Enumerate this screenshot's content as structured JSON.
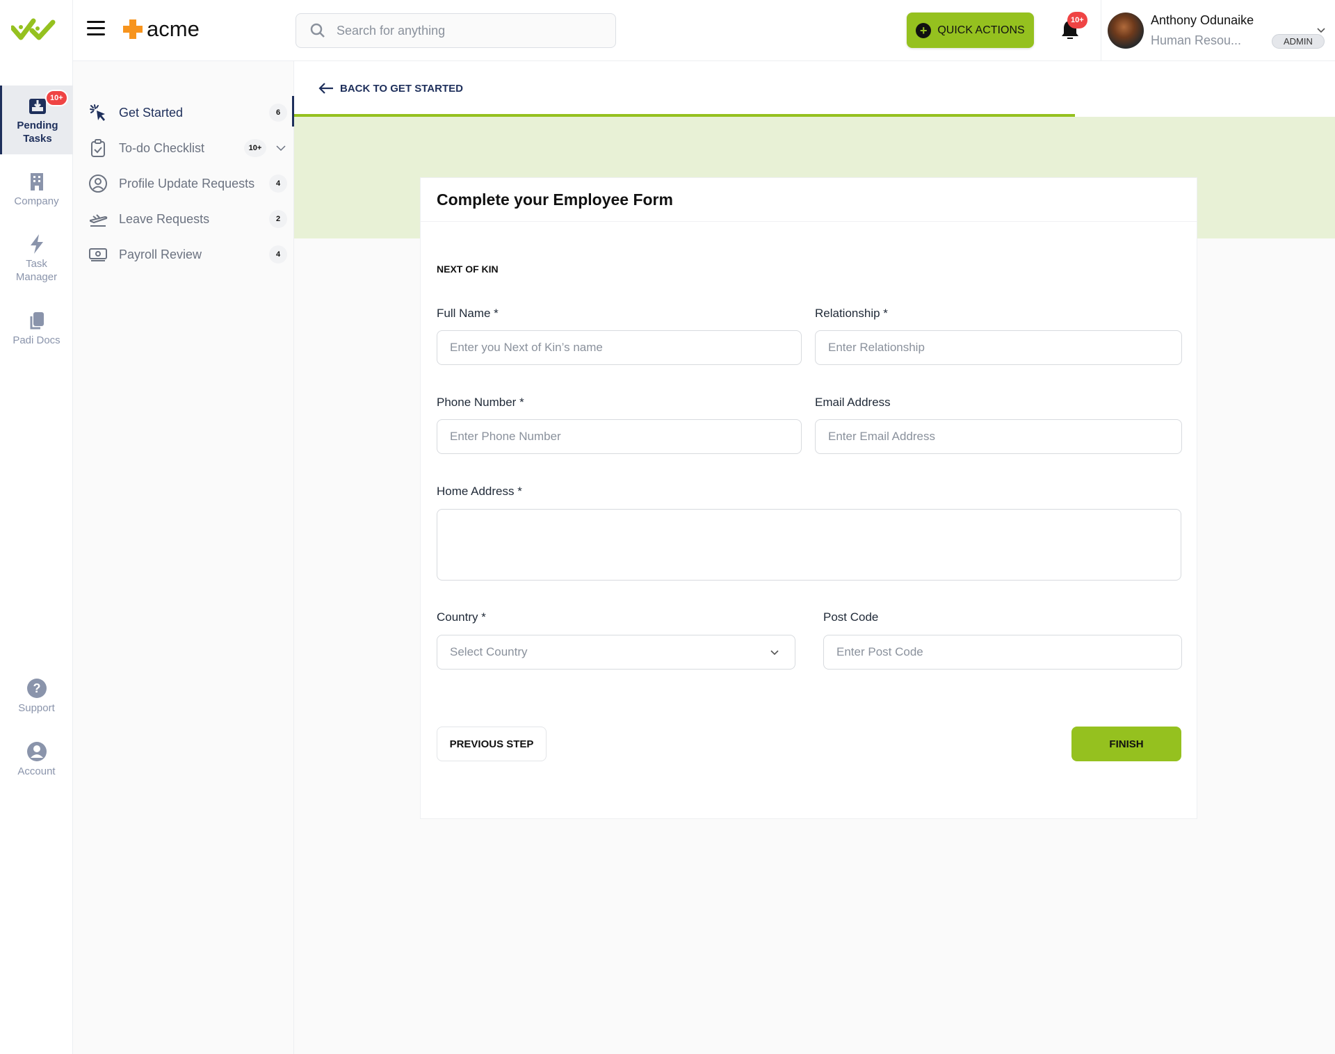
{
  "rail": {
    "items": [
      {
        "label_1": "Pending",
        "label_2": "Tasks",
        "badge": "10+",
        "active": true
      },
      {
        "label": "Company"
      },
      {
        "label_1": "Task",
        "label_2": "Manager"
      },
      {
        "label": "Padi Docs"
      }
    ],
    "bottom": [
      {
        "label": "Support"
      },
      {
        "label": "Account"
      }
    ]
  },
  "header": {
    "brand": "acme",
    "search_placeholder": "Search for anything",
    "quick_actions_label": "QUICK ACTIONS",
    "notifications_badge": "10+",
    "user": {
      "name": "Anthony Odunaike",
      "role": "Human Resou...",
      "badge": "ADMIN"
    }
  },
  "panel": {
    "items": [
      {
        "label": "Get Started",
        "count": "6",
        "active": true
      },
      {
        "label": "To-do Checklist",
        "count": "10+",
        "expandable": true
      },
      {
        "label": "Profile Update Requests",
        "count": "4"
      },
      {
        "label": "Leave Requests",
        "count": "2"
      },
      {
        "label": "Payroll Review",
        "count": "4"
      }
    ]
  },
  "main": {
    "back_label": "BACK TO GET STARTED",
    "progress_percent": 75,
    "colors": {
      "accent": "#95c11f",
      "navy": "#1e2f5b",
      "band": "#e8f1d6",
      "badge": "#ef4444"
    },
    "form": {
      "title": "Complete your Employee Form",
      "section": "NEXT OF KIN",
      "fields": {
        "full_name": {
          "label": "Full Name *",
          "placeholder": "Enter you Next of Kin’s name",
          "value": ""
        },
        "relationship": {
          "label": "Relationship *",
          "placeholder": "Enter Relationship",
          "value": ""
        },
        "phone": {
          "label": "Phone Number *",
          "placeholder": "Enter Phone Number",
          "value": ""
        },
        "email": {
          "label": "Email Address",
          "placeholder": "Enter Email Address",
          "value": ""
        },
        "home_address": {
          "label": "Home Address *",
          "placeholder": "",
          "value": ""
        },
        "country": {
          "label": "Country *",
          "selected": "Select Country"
        },
        "post_code": {
          "label": "Post Code",
          "placeholder": "Enter Post Code",
          "value": ""
        }
      },
      "previous_label": "PREVIOUS STEP",
      "finish_label": "FINISH"
    }
  }
}
